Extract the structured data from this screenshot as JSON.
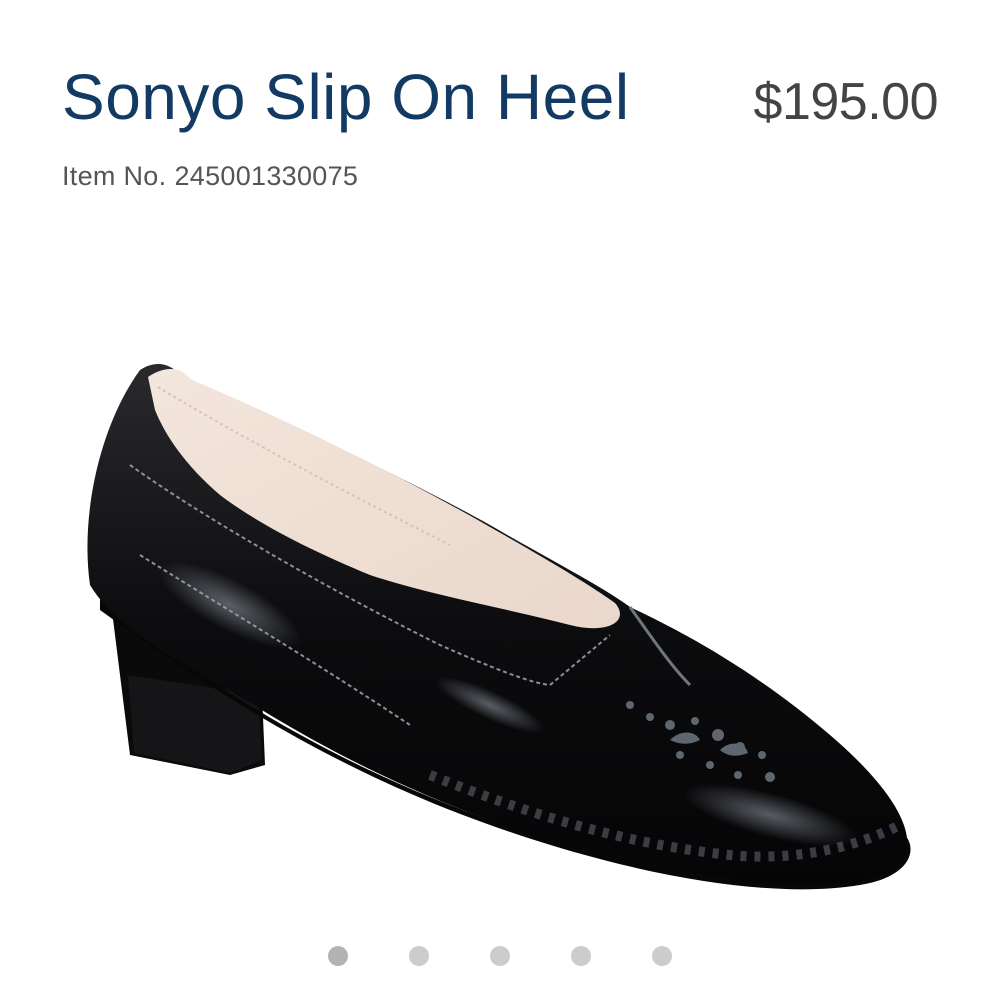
{
  "product": {
    "title": "Sonyo Slip On Heel",
    "price": "$195.00",
    "item_label": "Item No.",
    "item_number": "245001330075"
  },
  "image": {
    "subject": "black patent leather slip-on heel shoe"
  },
  "carousel": {
    "slide_count": 5,
    "active_index": 0
  },
  "colors": {
    "title": "#123a63",
    "price": "#444444",
    "dot": "#cccccc",
    "dot_active": "#b3b3b3"
  }
}
